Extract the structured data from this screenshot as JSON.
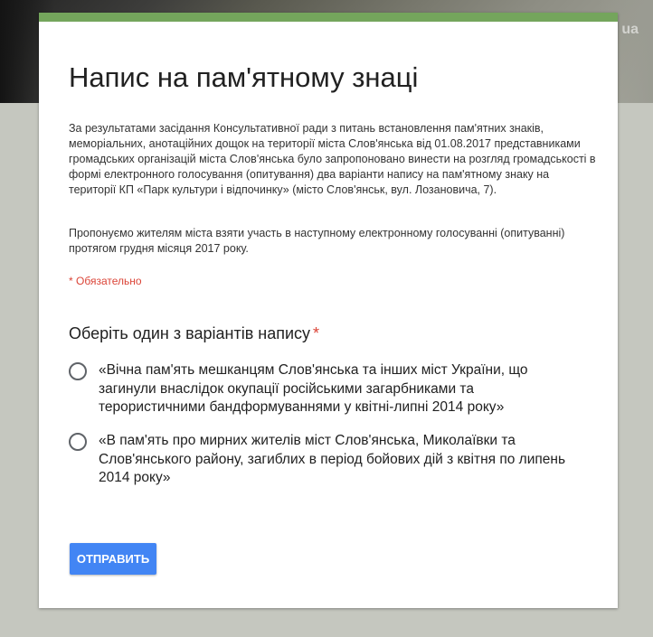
{
  "form": {
    "title": "Напис на пам'ятному знаці",
    "description_p1": "За результатами засідання Консультативної ради з питань встановлення пам'ятних знаків, меморіальних, анотаційних дощок на території міста Слов'янська  від 01.08.2017 представниками громадських організацій  міста Слов'янська було запропоновано винести на розгляд громадськості в  формі електронного голосування  (опитування) два варіанти напису на пам'ятному знаку на території КП  «Парк культури і відпочинку»  (місто Слов'янськ, вул. Лозановича, 7).",
    "description_p2": "Пропонуємо жителям  міста  взяти участь в наступному електронному голосуванні (опитуванні) протягом грудня місяця 2017 року.",
    "required_note": "* Обязательно",
    "question": {
      "label": "Оберіть один з варіантів напису",
      "required_mark": "*",
      "options": [
        {
          "label": "«Вічна пам'ять мешканцям Слов'янська та інших міст України, що загинули внаслідок окупації російськими загарбниками та терористичними бандформуваннями у квітні-липні 2014 року»",
          "selected": false
        },
        {
          "label": "«В пам'ять про мирних жителів міст Слов'янська, Миколаївки та Слов'янського району, загиблих в період бойових дій з квітня по липень 2014 року»",
          "selected": false
        }
      ]
    },
    "submit_label": "ОТПРАВИТЬ"
  },
  "watermark": "ua",
  "colors": {
    "accent_bar": "#74a55c",
    "submit_button": "#4285f4",
    "required": "#db4437",
    "page_background": "#c5c7bf"
  }
}
